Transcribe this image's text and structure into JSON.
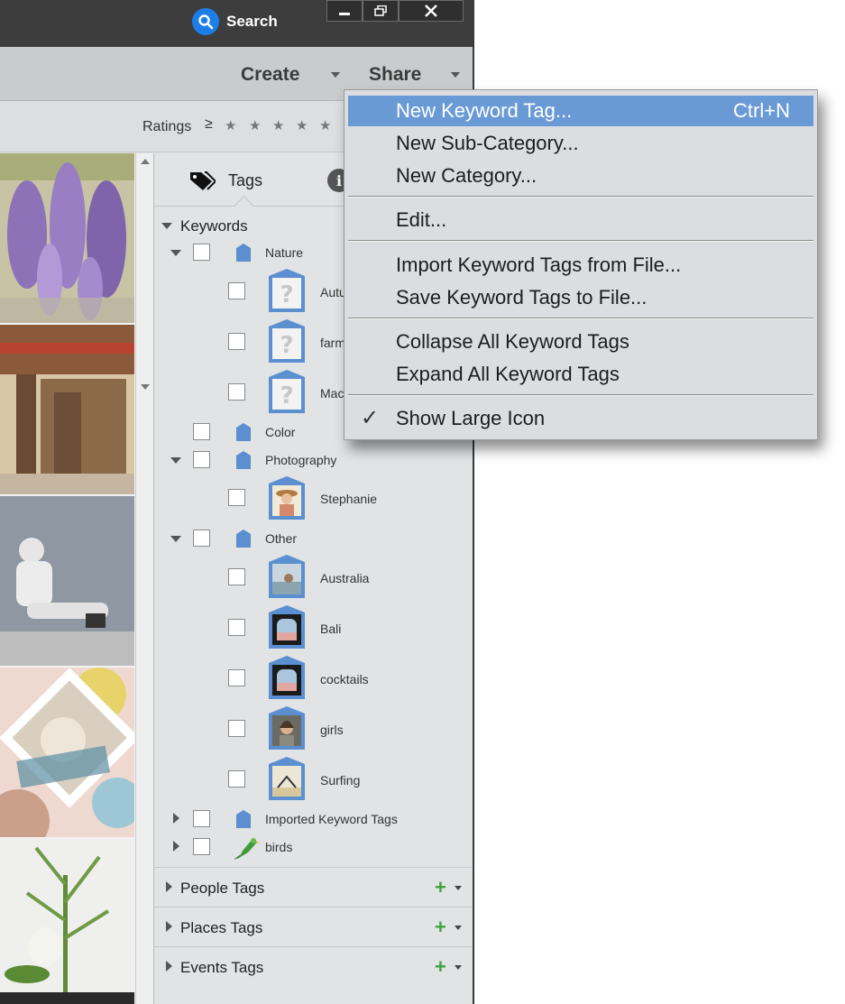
{
  "titlebar": {
    "search_label": "Search"
  },
  "toolbar": {
    "create_label": "Create",
    "share_label": "Share"
  },
  "filter": {
    "ratings_label": "Ratings",
    "ratings_op": "≥",
    "stars": 5
  },
  "panel": {
    "tab_tags": "Tags",
    "keywords_label": "Keywords",
    "tags": [
      {
        "label": "Nature"
      },
      {
        "label": "Autu"
      },
      {
        "label": "farm"
      },
      {
        "label": "Mac"
      },
      {
        "label": "Color"
      },
      {
        "label": "Photography"
      },
      {
        "label": "Stephanie"
      },
      {
        "label": "Other"
      },
      {
        "label": "Australia"
      },
      {
        "label": "Bali"
      },
      {
        "label": "cocktails"
      },
      {
        "label": "girls"
      },
      {
        "label": "Surfing"
      },
      {
        "label": "Imported Keyword Tags"
      },
      {
        "label": "birds"
      }
    ],
    "sections": [
      {
        "label": "People Tags"
      },
      {
        "label": "Places Tags"
      },
      {
        "label": "Events Tags"
      }
    ]
  },
  "context_menu": {
    "items": [
      {
        "label": "New Keyword Tag...",
        "shortcut": "Ctrl+N"
      },
      {
        "label": "New Sub-Category..."
      },
      {
        "label": "New Category..."
      },
      {
        "label": "Edit..."
      },
      {
        "label": "Import Keyword Tags from File..."
      },
      {
        "label": "Save Keyword Tags to File..."
      },
      {
        "label": "Collapse All Keyword Tags"
      },
      {
        "label": "Expand All Keyword Tags"
      },
      {
        "label": "Show Large Icon",
        "checked": true
      }
    ]
  }
}
